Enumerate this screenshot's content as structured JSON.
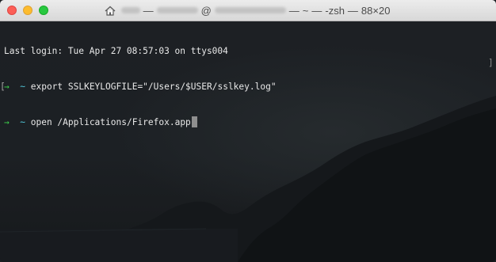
{
  "window": {
    "title_parts": {
      "at_sign": "@",
      "sep1": "—",
      "tilde": "~",
      "sep2": "—",
      "shell": "-zsh",
      "sep3": "—",
      "size": "88×20"
    },
    "traffic_lights": {
      "close_color": "#fc5f57",
      "minimize_color": "#fdbc2e",
      "zoom_color": "#28c840"
    }
  },
  "terminal": {
    "last_login": "Last login: Tue Apr 27 08:57:03 on ttys004",
    "commands": [
      {
        "arrow": "→",
        "dir": "~",
        "command": "export SSLKEYLOGFILE=\"/Users/$USER/sslkey.log\""
      },
      {
        "arrow": "→",
        "dir": "~",
        "command": "open /Applications/Firefox.app"
      }
    ],
    "prompt_arrow_color": "#3cd34b",
    "prompt_dir_color": "#52c7d9"
  }
}
